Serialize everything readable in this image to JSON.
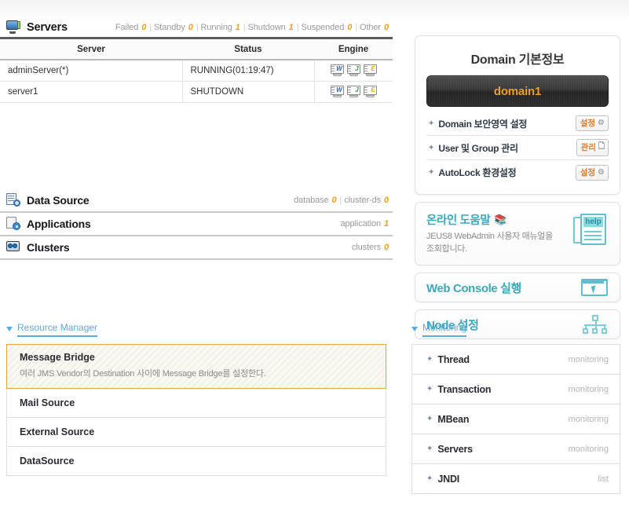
{
  "servers": {
    "icon": "monitor-icon",
    "title": "Servers",
    "stats": [
      {
        "label": "Failed",
        "value": "0"
      },
      {
        "label": "Standby",
        "value": "0"
      },
      {
        "label": "Running",
        "value": "1"
      },
      {
        "label": "Shutdown",
        "value": "1"
      },
      {
        "label": "Suspended",
        "value": "0"
      },
      {
        "label": "Other",
        "value": "0"
      }
    ],
    "columns": [
      "Server",
      "Status",
      "Engine"
    ],
    "rows": [
      {
        "server": "adminServer(*)",
        "status": "RUNNING(01:19:47)",
        "engines": [
          {
            "name": "web-engine-icon",
            "glyph": "W"
          },
          {
            "name": "ejb-engine-icon",
            "glyph": "J"
          },
          {
            "name": "jms-engine-icon",
            "glyph": "E"
          }
        ]
      },
      {
        "server": "server1",
        "status": "SHUTDOWN",
        "engines": [
          {
            "name": "web-engine-icon",
            "glyph": "W"
          },
          {
            "name": "ejb-engine-icon",
            "glyph": "J"
          },
          {
            "name": "jms-engine-icon",
            "glyph": "E"
          }
        ]
      }
    ]
  },
  "sections": [
    {
      "id": "data-source",
      "icon": "data-source-icon",
      "title": "Data Source",
      "stats": [
        {
          "label": "database",
          "value": "0"
        },
        {
          "label": "cluster-ds",
          "value": "0"
        }
      ]
    },
    {
      "id": "applications",
      "icon": "applications-icon",
      "title": "Applications",
      "stats": [
        {
          "label": "application",
          "value": "1"
        }
      ]
    },
    {
      "id": "clusters",
      "icon": "clusters-icon",
      "title": "Clusters",
      "stats": [
        {
          "label": "clusters",
          "value": "0"
        }
      ]
    }
  ],
  "resource_manager": {
    "title": "Resource Manager",
    "items": [
      {
        "label": "Message Bridge",
        "desc": "여러 JMS Vendor의 Destination 사이에 Message Bridge를 설정한다.",
        "selected": true
      },
      {
        "label": "Mail Source",
        "desc": "",
        "selected": false
      },
      {
        "label": "External Source",
        "desc": "",
        "selected": false
      },
      {
        "label": "DataSource",
        "desc": "",
        "selected": false
      }
    ]
  },
  "domain_panel": {
    "title": "Domain 기본정보",
    "domain_name": "domain1",
    "rows": [
      {
        "label": "Domain 보안영역 설정",
        "button": "설정",
        "button_icon": "gear-icon"
      },
      {
        "label": "User 및 Group 관리",
        "button": "관리",
        "button_icon": "document-icon"
      },
      {
        "label": "AutoLock 환경설정",
        "button": "설정",
        "button_icon": "gear-icon"
      }
    ]
  },
  "help_panel": {
    "title": "온라인 도움말",
    "desc": "JEUS8 WebAdmin 사용자 매뉴얼을 조회합니다.",
    "icon": "help-book-icon",
    "icon_text": "help"
  },
  "links": [
    {
      "label": "Web Console 실행",
      "icon": "web-console-icon"
    },
    {
      "label": "Node 설정",
      "icon": "node-tree-icon"
    }
  ],
  "monitoring": {
    "title": "Monitoring",
    "items": [
      {
        "label": "Thread",
        "action": "monitoring"
      },
      {
        "label": "Transaction",
        "action": "monitoring"
      },
      {
        "label": "MBean",
        "action": "monitoring"
      },
      {
        "label": "Servers",
        "action": "monitoring"
      },
      {
        "label": "JNDI",
        "action": "list"
      }
    ]
  },
  "colors": {
    "accent_orange": "#f0a020",
    "accent_blue": "#5aaae0",
    "accent_teal": "#3aa8b8",
    "highlight_border": "#e3a43c"
  }
}
